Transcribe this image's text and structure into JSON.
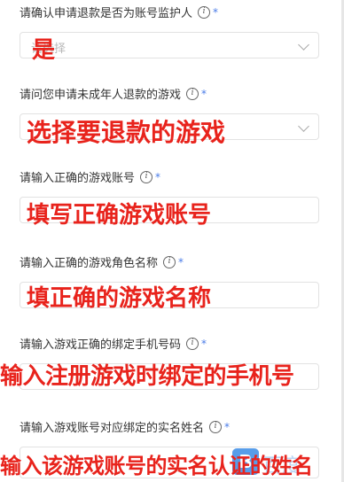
{
  "questions": [
    {
      "label": "请确认申请退款是否为账号监护人",
      "required_mark": "*",
      "placeholder": "请选择",
      "annotation": "是"
    },
    {
      "label": "请问您申请未成年人退款的游戏",
      "required_mark": "*",
      "placeholder": "",
      "annotation": "选择要退款的游戏"
    },
    {
      "label": "请输入正确的游戏账号",
      "required_mark": "*",
      "placeholder": "",
      "annotation": "填写正确游戏账号"
    },
    {
      "label": "请输入正确的游戏角色名称",
      "required_mark": "*",
      "placeholder": "",
      "annotation": "填正确的游戏名称"
    },
    {
      "label": "请输入游戏正确的绑定手机号码",
      "required_mark": "*",
      "placeholder": "",
      "annotation": "输入注册游戏时绑定的手机号"
    },
    {
      "label": "请输入游戏账号对应绑定的实名姓名",
      "required_mark": "*",
      "placeholder": "",
      "annotation": "输入该游戏账号的实名认证的姓名"
    }
  ],
  "info_icon_glyph": "i",
  "watermark": {
    "logo_letter": "B",
    "text": "百度"
  },
  "colors": {
    "annotation": "#e8231c",
    "required": "#4a7be8",
    "border": "#e2e2e2"
  }
}
